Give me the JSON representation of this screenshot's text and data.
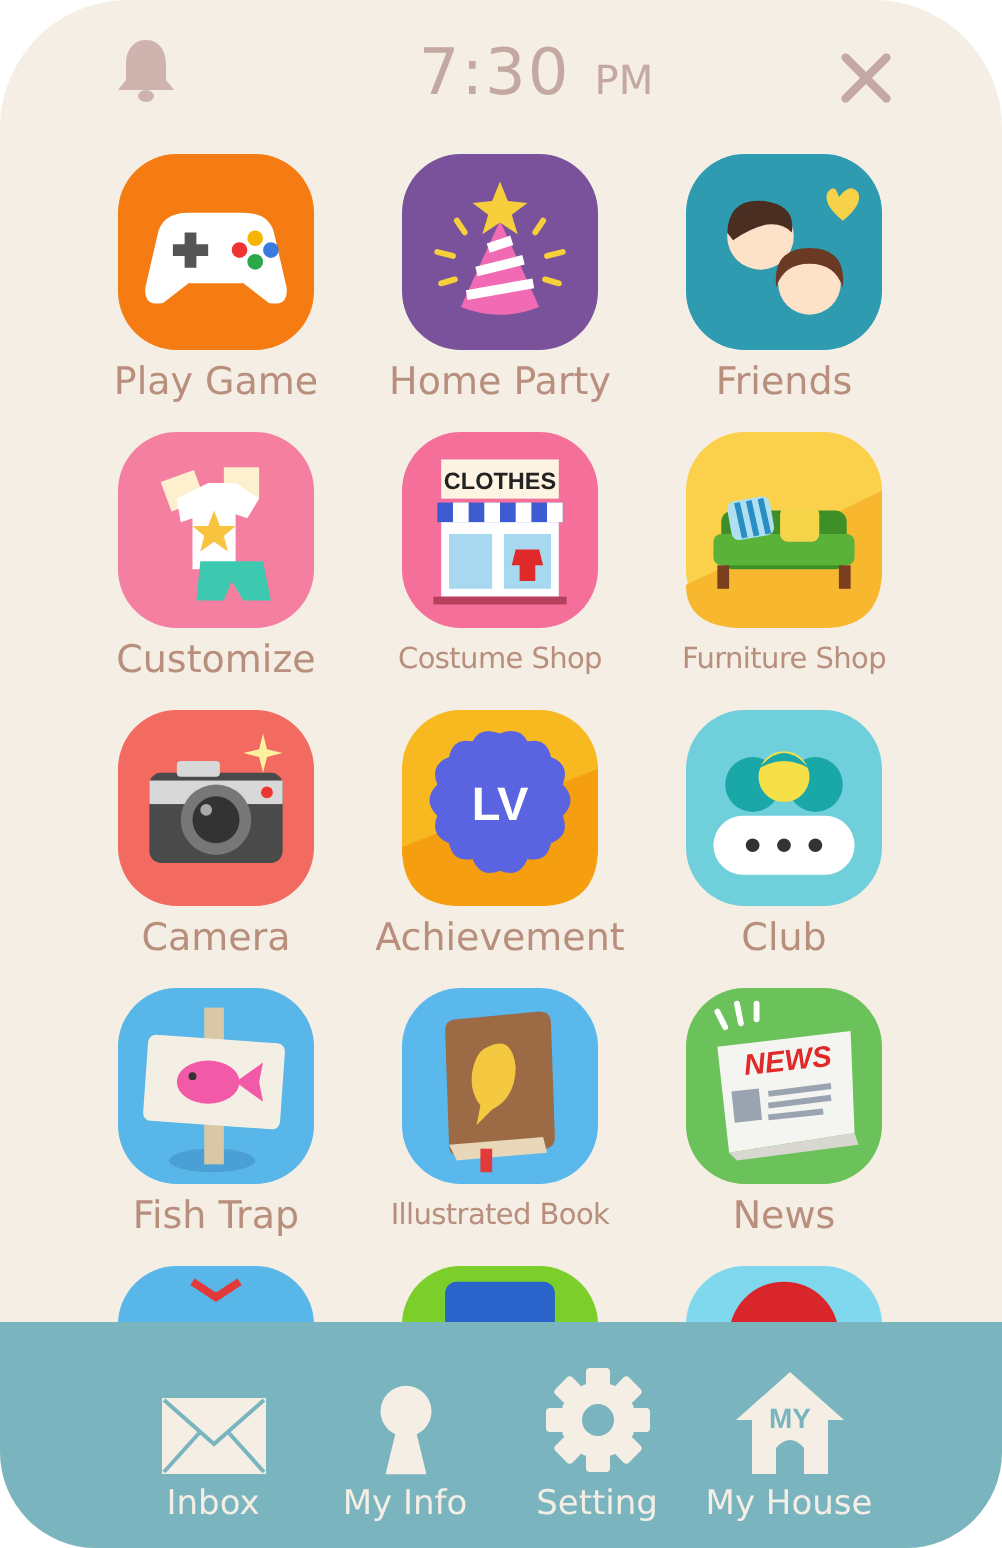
{
  "status": {
    "time": "7:30",
    "period": "PM"
  },
  "apps": [
    {
      "label": "Play Game",
      "kind": "gamepad"
    },
    {
      "label": "Home Party",
      "kind": "party"
    },
    {
      "label": "Friends",
      "kind": "friends"
    },
    {
      "label": "Customize",
      "kind": "clothes"
    },
    {
      "label": "Costume Shop",
      "kind": "shop",
      "compact": true,
      "icon_text": "CLOTHES"
    },
    {
      "label": "Furniture Shop",
      "kind": "sofa",
      "compact": true
    },
    {
      "label": "Camera",
      "kind": "camera"
    },
    {
      "label": "Achievement",
      "kind": "level",
      "icon_text": "LV"
    },
    {
      "label": "Club",
      "kind": "club"
    },
    {
      "label": "Fish Trap",
      "kind": "fishsign"
    },
    {
      "label": "Illustrated Book",
      "kind": "book",
      "compact": true
    },
    {
      "label": "News",
      "kind": "news",
      "icon_text": "NEWS"
    },
    {
      "kind": "bow"
    },
    {
      "kind": "screen"
    },
    {
      "kind": "ball"
    }
  ],
  "nav": [
    {
      "label": "Inbox",
      "kind": "mail"
    },
    {
      "label": "My Info",
      "kind": "person"
    },
    {
      "label": "Setting",
      "kind": "gear"
    },
    {
      "label": "My House",
      "kind": "house",
      "icon_text": "MY"
    }
  ]
}
